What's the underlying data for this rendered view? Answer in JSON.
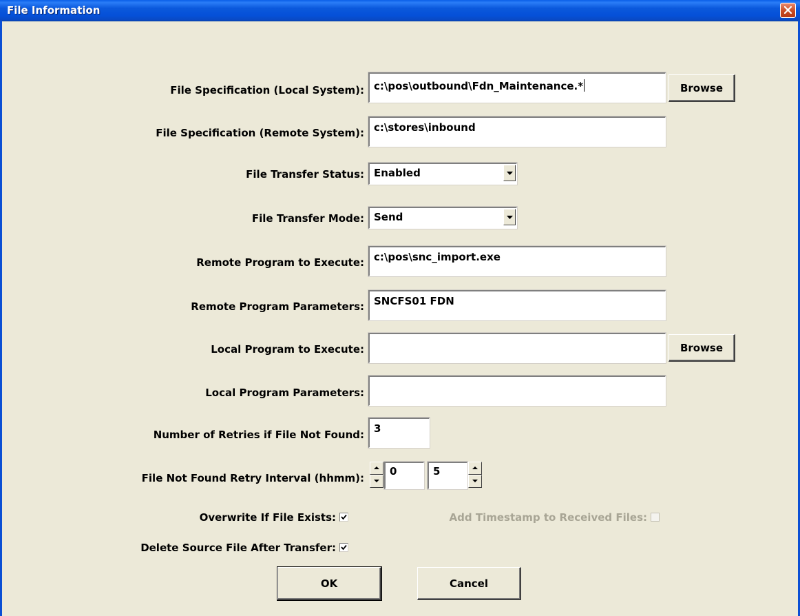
{
  "window": {
    "title": "File Information"
  },
  "fields": {
    "local_spec": {
      "label": "File Specification (Local System):",
      "value": "c:\\pos\\outbound\\Fdn_Maintenance.*"
    },
    "remote_spec": {
      "label": "File Specification (Remote System):",
      "value": "c:\\stores\\inbound"
    },
    "transfer_status": {
      "label": "File Transfer Status:",
      "value": "Enabled"
    },
    "transfer_mode": {
      "label": "File Transfer Mode:",
      "value": "Send"
    },
    "remote_program": {
      "label": "Remote Program to Execute:",
      "value": "c:\\pos\\snc_import.exe"
    },
    "remote_params": {
      "label": "Remote Program Parameters:",
      "value": "SNCFS01 FDN"
    },
    "local_program": {
      "label": "Local Program to Execute:",
      "value": ""
    },
    "local_params": {
      "label": "Local Program Parameters:",
      "value": ""
    },
    "retries": {
      "label": "Number of Retries if File Not Found:",
      "value": "3"
    },
    "retry_interval": {
      "label": "File Not Found Retry Interval (hhmm):",
      "hours": "0",
      "minutes": "5"
    }
  },
  "checkboxes": {
    "overwrite": {
      "label": "Overwrite If File Exists:",
      "checked": true
    },
    "timestamp": {
      "label": "Add Timestamp to Received Files:",
      "checked": false,
      "disabled": true
    },
    "delete_source": {
      "label": "Delete Source File After Transfer:",
      "checked": true
    }
  },
  "buttons": {
    "browse_local": "Browse",
    "browse_local_program": "Browse",
    "ok": "OK",
    "cancel": "Cancel"
  },
  "icons": {
    "close": "close-icon",
    "dropdown": "chevron-down-icon",
    "spin_up": "arrow-up-icon",
    "spin_down": "arrow-down-icon",
    "check": "checkmark-icon"
  },
  "colors": {
    "titlebar": "#0b59dc",
    "dialog_bg": "#ece9d8",
    "close_button": "#c94a22",
    "disabled_text": "#a8a595"
  }
}
